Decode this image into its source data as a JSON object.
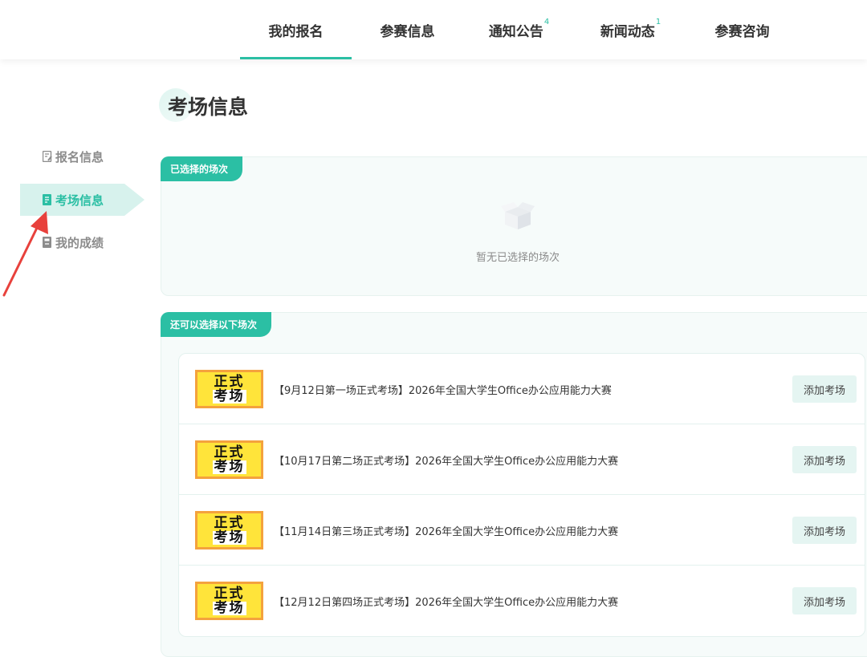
{
  "nav": {
    "tabs": [
      {
        "label": "我的报名",
        "badge": ""
      },
      {
        "label": "参赛信息",
        "badge": ""
      },
      {
        "label": "通知公告",
        "badge": "4"
      },
      {
        "label": "新闻动态",
        "badge": "1"
      },
      {
        "label": "参赛咨询",
        "badge": ""
      }
    ],
    "active_index": 0
  },
  "sidebar": {
    "items": [
      {
        "label": "报名信息",
        "icon": "edit-icon"
      },
      {
        "label": "考场信息",
        "icon": "exam-room-icon"
      },
      {
        "label": "我的成绩",
        "icon": "score-icon"
      }
    ],
    "active_index": 1
  },
  "page": {
    "title": "考场信息"
  },
  "selected": {
    "tag": "已选择的场次",
    "empty_text": "暂无已选择的场次"
  },
  "available": {
    "tag": "还可以选择以下场次",
    "thumb_line1": "正式",
    "thumb_line2": "考场",
    "sessions": [
      {
        "title": "【9月12日第一场正式考场】2026年全国大学生Office办公应用能力大赛",
        "button": "添加考场"
      },
      {
        "title": "【10月17日第二场正式考场】2026年全国大学生Office办公应用能力大赛",
        "button": "添加考场"
      },
      {
        "title": "【11月14日第三场正式考场】2026年全国大学生Office办公应用能力大赛",
        "button": "添加考场"
      },
      {
        "title": "【12月12日第四场正式考场】2026年全国大学生Office办公应用能力大赛",
        "button": "添加考场"
      }
    ]
  },
  "colors": {
    "accent": "#2bbfa4",
    "accent_light": "#d7f2ed",
    "annotation_arrow": "#e8413c"
  }
}
